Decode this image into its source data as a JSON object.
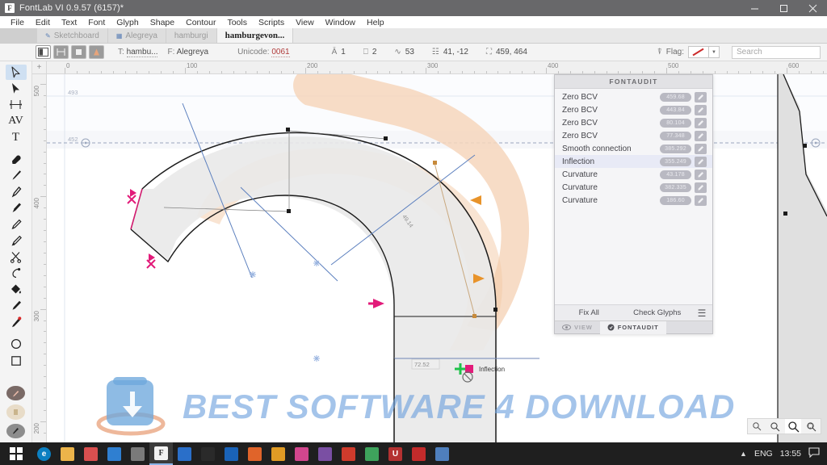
{
  "window": {
    "title": "FontLab VI 0.9.57 (6157)*",
    "app_icon": "F",
    "minimize": "minimize-icon",
    "maximize": "maximize-icon",
    "close": "close-icon"
  },
  "menu": {
    "items": [
      "File",
      "Edit",
      "Text",
      "Font",
      "Glyph",
      "Shape",
      "Contour",
      "Tools",
      "Scripts",
      "View",
      "Window",
      "Help"
    ]
  },
  "tabs": [
    {
      "label": "Sketchboard",
      "state": "ghost"
    },
    {
      "label": "Alegreya",
      "state": "ghost"
    },
    {
      "label": "hamburgi",
      "state": "dim"
    },
    {
      "label": "hamburgevon...",
      "state": "active"
    }
  ],
  "glyphbar": {
    "text_label": "T:",
    "text_value": "hambu...",
    "font_label": "F:",
    "font_value": "Alegreya",
    "unicode_label": "Unicode:",
    "unicode_value": "0061",
    "metrics": [
      {
        "icon": "glyph-count-icon",
        "value": "1"
      },
      {
        "icon": "layers-icon",
        "value": "2"
      },
      {
        "icon": "nodes-icon",
        "value": "53"
      },
      {
        "icon": "position-icon",
        "value": "41, -12"
      },
      {
        "icon": "size-icon",
        "value": "459, 464"
      }
    ],
    "flag_label": "Flag:",
    "flag_color": "#cc2b2b",
    "search_placeholder": "Search"
  },
  "tools": [
    {
      "name": "select-arrow-tool",
      "selected": true
    },
    {
      "name": "move-arrow-tool",
      "selected": false
    },
    {
      "name": "metrics-tool",
      "selected": false
    },
    {
      "name": "kerning-tool",
      "selected": false
    },
    {
      "name": "text-tool",
      "selected": false
    },
    {
      "name": "eraser-tool",
      "selected": false
    },
    {
      "name": "brush-tool",
      "selected": false
    },
    {
      "name": "pen-tool",
      "selected": false
    },
    {
      "name": "rapid-tool",
      "selected": false
    },
    {
      "name": "pencil-tool",
      "selected": false
    },
    {
      "name": "fill-brush-tool",
      "selected": false
    },
    {
      "name": "scissors-tool",
      "selected": false
    },
    {
      "name": "knife-tool",
      "selected": false
    },
    {
      "name": "paint-bucket-tool",
      "selected": false
    },
    {
      "name": "marker-tool",
      "selected": false
    },
    {
      "name": "eyedropper-tool",
      "selected": false
    },
    {
      "name": "ellipse-tool",
      "selected": false
    },
    {
      "name": "rectangle-tool",
      "selected": false
    }
  ],
  "rulers": {
    "horizontal_labels": [
      "0",
      "100",
      "200",
      "300",
      "400",
      "500",
      "600"
    ],
    "vertical_labels": [
      "500",
      "400",
      "300",
      "200"
    ],
    "guides": [
      "493",
      "452"
    ]
  },
  "canvas": {
    "measure_label": "72.52",
    "node_label": "Inflection",
    "curve_label": "49.14"
  },
  "fontaudit": {
    "title": "FONTAUDIT",
    "rows": [
      {
        "name": "Zero BCV",
        "value": "459.68"
      },
      {
        "name": "Zero BCV",
        "value": "443.84"
      },
      {
        "name": "Zero BCV",
        "value": "80.104"
      },
      {
        "name": "Zero BCV",
        "value": "77.348"
      },
      {
        "name": "Smooth connection",
        "value": "385.292"
      },
      {
        "name": "Inflection",
        "value": "355.249",
        "selected": true
      },
      {
        "name": "Curvature",
        "value": "43.178"
      },
      {
        "name": "Curvature",
        "value": "382.335"
      },
      {
        "name": "Curvature",
        "value": "186.60"
      }
    ],
    "fix_all": "Fix All",
    "check_glyphs": "Check Glyphs",
    "menu_icon": "hamburger-menu-icon",
    "tabs": [
      {
        "label": "VIEW",
        "icon": "eye-icon",
        "active": false
      },
      {
        "label": "FONTAUDIT",
        "icon": "fontaudit-icon",
        "active": true
      }
    ]
  },
  "zoom_controls": [
    {
      "name": "zoom-fit-icon",
      "active": false
    },
    {
      "name": "zoom-selection-icon",
      "active": false
    },
    {
      "name": "zoom-100-icon",
      "active": true
    },
    {
      "name": "zoom-area-icon",
      "active": false
    }
  ],
  "watermark": {
    "text": "BEST SOFTWARE 4 DOWNLOAD"
  },
  "taskbar": {
    "start": "windows-start-icon",
    "apps": [
      {
        "name": "edge-icon",
        "color": "#0b7fc1",
        "glyph": "e"
      },
      {
        "name": "file-explorer-icon",
        "color": "#ecb44a",
        "glyph": ""
      },
      {
        "name": "save-app-icon",
        "color": "#d94f4f",
        "glyph": ""
      },
      {
        "name": "excel-icon",
        "color": "#2f7fd1",
        "glyph": ""
      },
      {
        "name": "book-app-icon",
        "color": "#7a7a7a",
        "glyph": ""
      },
      {
        "name": "fontlab-icon",
        "color": "#f2f2f2",
        "glyph": "F"
      },
      {
        "name": "sketch-icon",
        "color": "#2a6fc9",
        "glyph": ""
      },
      {
        "name": "dark-app-icon",
        "color": "#2a2a2a",
        "glyph": ""
      },
      {
        "name": "blue-app-icon",
        "color": "#1a63b8",
        "glyph": ""
      },
      {
        "name": "orange-app-icon",
        "color": "#e0642a",
        "glyph": ""
      },
      {
        "name": "amber-app-icon",
        "color": "#e09b25",
        "glyph": ""
      },
      {
        "name": "pink-app-icon",
        "color": "#d2468d",
        "glyph": ""
      },
      {
        "name": "onenote-icon",
        "color": "#7a4fa3",
        "glyph": ""
      },
      {
        "name": "acrobat-icon",
        "color": "#cf3b2c",
        "glyph": ""
      },
      {
        "name": "map-app-icon",
        "color": "#3ea35c",
        "glyph": ""
      },
      {
        "name": "u-app-icon",
        "color": "#b43131",
        "glyph": "U"
      },
      {
        "name": "red-app-icon",
        "color": "#c32b2b",
        "glyph": ""
      },
      {
        "name": "doc-app-icon",
        "color": "#4f7fbd",
        "glyph": ""
      }
    ],
    "language": "ENG",
    "clock": "13:55",
    "notification": "notification-icon"
  }
}
